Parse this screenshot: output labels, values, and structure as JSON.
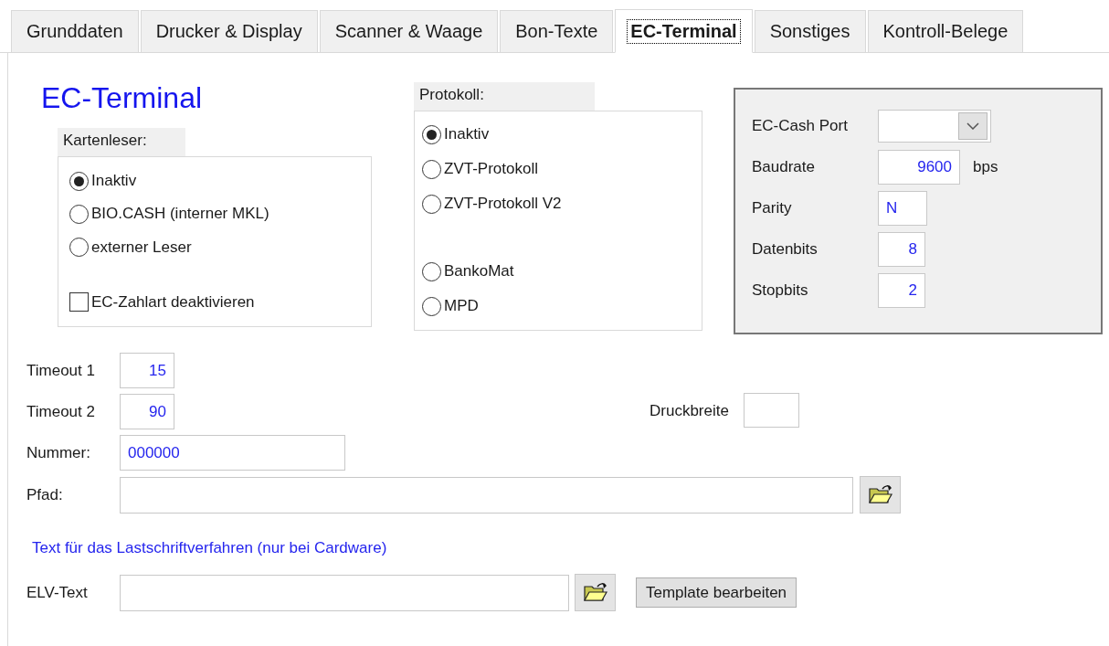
{
  "tabs": [
    {
      "label": "Grunddaten",
      "selected": false
    },
    {
      "label": "Drucker & Display",
      "selected": false
    },
    {
      "label": "Scanner & Waage",
      "selected": false
    },
    {
      "label": "Bon-Texte",
      "selected": false
    },
    {
      "label": "EC-Terminal",
      "selected": true
    },
    {
      "label": "Sonstiges",
      "selected": false
    },
    {
      "label": "Kontroll-Belege",
      "selected": false
    }
  ],
  "title": "EC-Terminal",
  "card_reader": {
    "label": "Kartenleser:",
    "options": [
      {
        "label": "Inaktiv",
        "selected": true
      },
      {
        "label": "BIO.CASH (interner MKL)",
        "selected": false
      },
      {
        "label": "externer Leser",
        "selected": false
      }
    ],
    "checkbox": {
      "label": "EC-Zahlart deaktivieren",
      "checked": false
    }
  },
  "protocol": {
    "label": "Protokoll:",
    "option_groups": [
      {
        "options": [
          {
            "label": "Inaktiv",
            "selected": true
          },
          {
            "label": "ZVT-Protokoll",
            "selected": false
          },
          {
            "label": "ZVT-Protokoll V2",
            "selected": false
          }
        ]
      },
      {
        "options": [
          {
            "label": "BankoMat",
            "selected": false
          },
          {
            "label": "MPD",
            "selected": false
          }
        ]
      }
    ]
  },
  "port_settings": [
    {
      "kind": "dropdown",
      "label": "EC-Cash Port"
    },
    {
      "kind": "text",
      "label": "Baudrate",
      "value": "9600",
      "unit": "bps"
    },
    {
      "kind": "text",
      "label": "Parity",
      "value": "N"
    },
    {
      "kind": "text",
      "label": "Datenbits",
      "value": "8"
    },
    {
      "kind": "text",
      "label": "Stopbits",
      "value": "2"
    }
  ],
  "timeouts": [
    {
      "label": "Timeout 1",
      "value": "15"
    },
    {
      "label": "Timeout 2",
      "value": "90"
    }
  ],
  "print_width": {
    "label": "Druckbreite"
  },
  "number": {
    "label": "Nummer:",
    "value": "000000"
  },
  "path": {
    "label": "Pfad:"
  },
  "elv_heading": "Text für das Lastschriftverfahren (nur bei Cardware)",
  "elv": {
    "label": "ELV-Text"
  },
  "template_button": "Template bearbeiten"
}
